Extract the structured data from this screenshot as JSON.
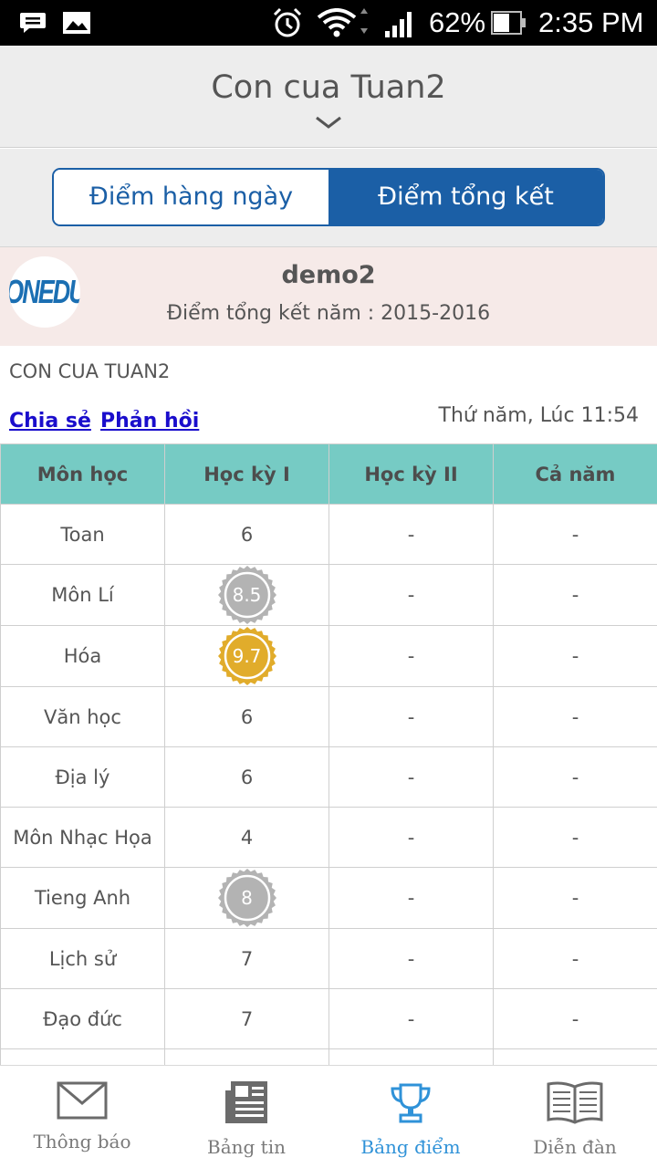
{
  "status_bar": {
    "battery": "62%",
    "time": "2:35 PM",
    "icons": [
      "message-icon",
      "image-icon",
      "alarm-icon",
      "wifi-icon",
      "signal-icon",
      "battery-icon"
    ]
  },
  "header": {
    "title": "Con cua Tuan2",
    "chevron_icon": "chevron-down-icon"
  },
  "tabs": {
    "daily": "Điểm hàng ngày",
    "summary": "Điểm tổng kết",
    "active": "summary"
  },
  "student": {
    "logo_text": "ONEDU",
    "name": "demo2",
    "subtitle": "Điểm tổng kết năm : 2015-2016"
  },
  "class_name": "CON CUA TUAN2",
  "actions": {
    "share": "Chia sẻ",
    "feedback": "Phản hồi"
  },
  "timestamp": "Thứ năm, Lúc 11:54",
  "table": {
    "headers": [
      "Môn học",
      "Học kỳ I",
      "Học kỳ II",
      "Cả năm"
    ],
    "rows": [
      {
        "subject": "Toan",
        "hk1": "6",
        "hk2": "-",
        "year": "-",
        "medal": ""
      },
      {
        "subject": "Môn Lí",
        "hk1": "8.5",
        "hk2": "-",
        "year": "-",
        "medal": "silver"
      },
      {
        "subject": "Hóa",
        "hk1": "9.7",
        "hk2": "-",
        "year": "-",
        "medal": "gold"
      },
      {
        "subject": "Văn học",
        "hk1": "6",
        "hk2": "-",
        "year": "-",
        "medal": ""
      },
      {
        "subject": "Địa lý",
        "hk1": "6",
        "hk2": "-",
        "year": "-",
        "medal": ""
      },
      {
        "subject": "Môn Nhạc Họa",
        "hk1": "4",
        "hk2": "-",
        "year": "-",
        "medal": ""
      },
      {
        "subject": "Tieng Anh",
        "hk1": "8",
        "hk2": "-",
        "year": "-",
        "medal": "silver"
      },
      {
        "subject": "Lịch sử",
        "hk1": "7",
        "hk2": "-",
        "year": "-",
        "medal": ""
      },
      {
        "subject": "Đạo đức",
        "hk1": "7",
        "hk2": "-",
        "year": "-",
        "medal": ""
      },
      {
        "subject": "",
        "hk1": "",
        "hk2": "",
        "year": "",
        "medal": ""
      }
    ]
  },
  "bottom_nav": [
    {
      "label": "Thông báo",
      "icon": "envelope-icon",
      "active": false
    },
    {
      "label": "Bảng tin",
      "icon": "newspaper-icon",
      "active": false
    },
    {
      "label": "Bảng điểm",
      "icon": "trophy-icon",
      "active": true
    },
    {
      "label": "Diễn đàn",
      "icon": "book-icon",
      "active": false
    }
  ],
  "colors": {
    "primary": "#1b5fa6",
    "table_header": "#76cbc4",
    "card_bg": "#f6eae8",
    "link": "#1a0dcc",
    "nav_active": "#2f92d8",
    "medal_silver": "#b3b3b3",
    "medal_gold": "#e1ac2b"
  }
}
